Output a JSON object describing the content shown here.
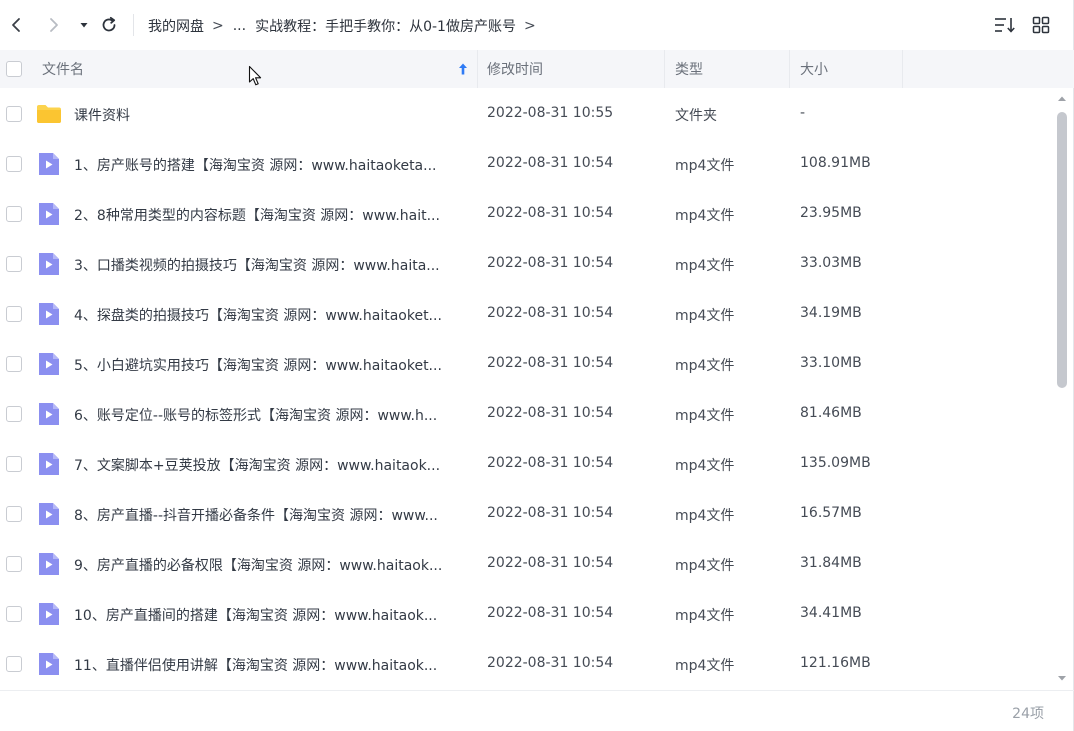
{
  "nav": {
    "breadcrumb": [
      "我的网盘",
      "...",
      "实战教程：手把手教你：从0-1做房产账号"
    ],
    "separator": ">"
  },
  "columns": {
    "name": "文件名",
    "mtime": "修改时间",
    "type": "类型",
    "size": "大小"
  },
  "files": [
    {
      "name": "课件资料",
      "mtime": "2022-08-31 10:55",
      "type": "文件夹",
      "size": "-",
      "icon": "folder-icon"
    },
    {
      "name": "1、房产账号的搭建【海淘宝资 源网：www.haitaoketa...",
      "mtime": "2022-08-31 10:54",
      "type": "mp4文件",
      "size": "108.91MB",
      "icon": "video-file-icon"
    },
    {
      "name": "2、8种常用类型的内容标题【海淘宝资 源网：www.hait...",
      "mtime": "2022-08-31 10:54",
      "type": "mp4文件",
      "size": "23.95MB",
      "icon": "video-file-icon"
    },
    {
      "name": "3、口播类视频的拍摄技巧【海淘宝资 源网：www.haita...",
      "mtime": "2022-08-31 10:54",
      "type": "mp4文件",
      "size": "33.03MB",
      "icon": "video-file-icon"
    },
    {
      "name": "4、探盘类的拍摄技巧【海淘宝资 源网：www.haitaoket...",
      "mtime": "2022-08-31 10:54",
      "type": "mp4文件",
      "size": "34.19MB",
      "icon": "video-file-icon"
    },
    {
      "name": "5、小白避坑实用技巧【海淘宝资 源网：www.haitaoket...",
      "mtime": "2022-08-31 10:54",
      "type": "mp4文件",
      "size": "33.10MB",
      "icon": "video-file-icon"
    },
    {
      "name": "6、账号定位--账号的标签形式【海淘宝资 源网：www.h...",
      "mtime": "2022-08-31 10:54",
      "type": "mp4文件",
      "size": "81.46MB",
      "icon": "video-file-icon"
    },
    {
      "name": "7、文案脚本+豆荚投放【海淘宝资 源网：www.haitaok...",
      "mtime": "2022-08-31 10:54",
      "type": "mp4文件",
      "size": "135.09MB",
      "icon": "video-file-icon"
    },
    {
      "name": "8、房产直播--抖音开播必备条件【海淘宝资 源网：www...",
      "mtime": "2022-08-31 10:54",
      "type": "mp4文件",
      "size": "16.57MB",
      "icon": "video-file-icon"
    },
    {
      "name": "9、房产直播的必备权限【海淘宝资 源网：www.haitaok...",
      "mtime": "2022-08-31 10:54",
      "type": "mp4文件",
      "size": "31.84MB",
      "icon": "video-file-icon"
    },
    {
      "name": "10、房产直播间的搭建【海淘宝资 源网：www.haitaok...",
      "mtime": "2022-08-31 10:54",
      "type": "mp4文件",
      "size": "34.41MB",
      "icon": "video-file-icon"
    },
    {
      "name": "11、直播伴侣使用讲解【海淘宝资 源网：www.haitaok...",
      "mtime": "2022-08-31 10:54",
      "type": "mp4文件",
      "size": "121.16MB",
      "icon": "video-file-icon"
    }
  ],
  "footer": {
    "count": "24项"
  },
  "colors": {
    "folder": "#fcd34d",
    "video_file": "#8b8ff0",
    "sort_arrow": "#2f7bf5",
    "header_bg": "#f5f6f9"
  }
}
